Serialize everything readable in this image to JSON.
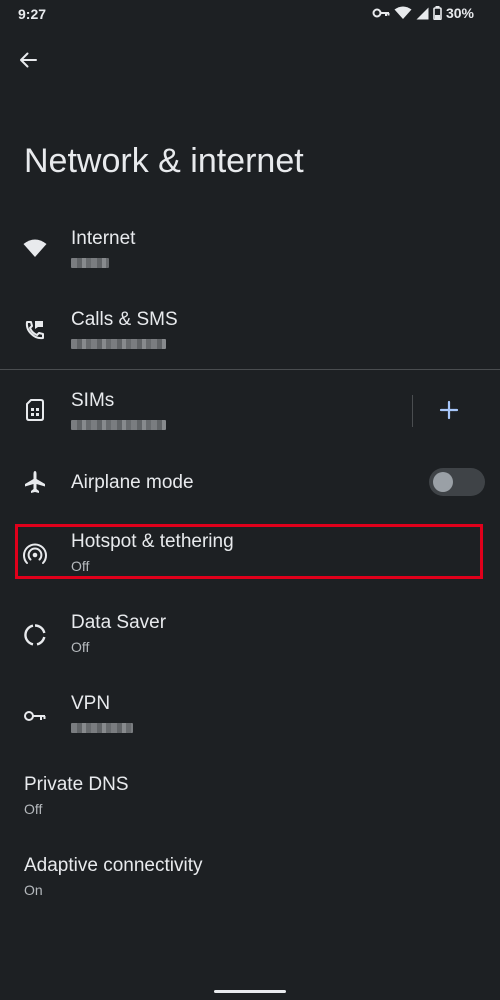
{
  "status_bar": {
    "time": "9:27",
    "battery": "30%"
  },
  "header": {
    "title": "Network & internet"
  },
  "items": [
    {
      "title": "Internet",
      "subtitle": "",
      "icon": "wifi-icon"
    },
    {
      "title": "Calls & SMS",
      "subtitle": "",
      "icon": "calls-sms-icon"
    },
    {
      "title": "SIMs",
      "subtitle": "",
      "icon": "sim-card-icon"
    },
    {
      "title": "Airplane mode",
      "subtitle": "",
      "icon": "airplane-icon",
      "toggle_on": false
    },
    {
      "title": "Hotspot & tethering",
      "subtitle": "Off",
      "icon": "hotspot-icon"
    },
    {
      "title": "Data Saver",
      "subtitle": "Off",
      "icon": "data-saver-icon"
    },
    {
      "title": "VPN",
      "subtitle": "",
      "icon": "vpn-key-icon"
    },
    {
      "title": "Private DNS",
      "subtitle": "Off"
    },
    {
      "title": "Adaptive connectivity",
      "subtitle": "On"
    }
  ],
  "colors": {
    "background": "#1d2023",
    "accent": "#a8c7fa",
    "highlight": "#e0001b"
  }
}
